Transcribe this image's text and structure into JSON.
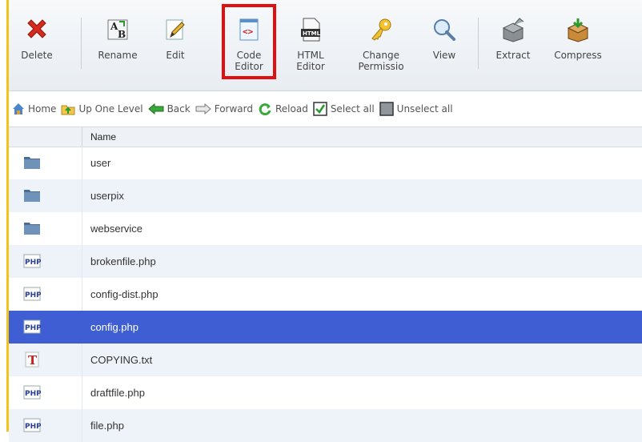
{
  "toolbar": {
    "delete": "Delete",
    "rename": "Rename",
    "edit": "Edit",
    "code_editor_l1": "Code",
    "code_editor_l2": "Editor",
    "html_editor_l1": "HTML",
    "html_editor_l2": "Editor",
    "change_perm_l1": "Change",
    "change_perm_l2": "Permissio",
    "view": "View",
    "extract": "Extract",
    "compress": "Compress"
  },
  "nav": {
    "home": "Home",
    "up": "Up One Level",
    "back": "Back",
    "forward": "Forward",
    "reload": "Reload",
    "select_all": "Select all",
    "unselect_all": "Unselect all"
  },
  "table": {
    "header_name": "Name",
    "rows": [
      {
        "name": "user",
        "icon": "folder-icon"
      },
      {
        "name": "userpix",
        "icon": "folder-icon"
      },
      {
        "name": "webservice",
        "icon": "folder-icon"
      },
      {
        "name": "brokenfile.php",
        "icon": "php-file-icon"
      },
      {
        "name": "config-dist.php",
        "icon": "php-file-icon"
      },
      {
        "name": "config.php",
        "icon": "php-file-icon"
      },
      {
        "name": "COPYING.txt",
        "icon": "text-file-icon"
      },
      {
        "name": "draftfile.php",
        "icon": "php-file-icon"
      },
      {
        "name": "file.php",
        "icon": "php-file-icon"
      }
    ]
  },
  "colors": {
    "selected_row": "#3f5ed3",
    "highlight_box": "#e01010"
  }
}
